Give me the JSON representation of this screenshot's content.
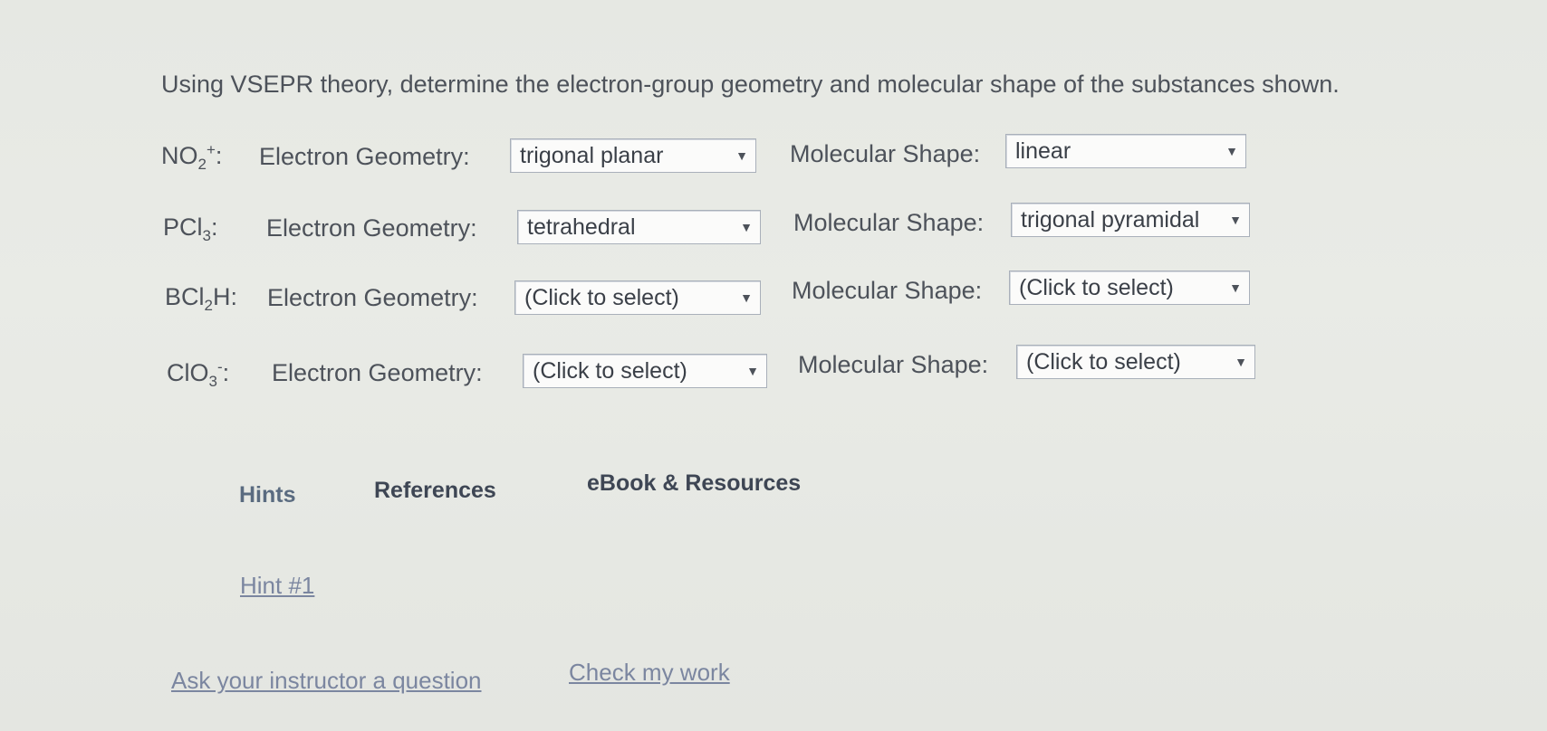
{
  "question": "Using VSEPR theory, determine the electron-group geometry and molecular shape of the substances shown.",
  "rows": [
    {
      "formula_base": "NO",
      "formula_sub": "2",
      "formula_sup": "+",
      "formula_end": ":",
      "eg_label": "Electron Geometry:",
      "eg_value": "trigonal planar",
      "ms_label": "Molecular Shape:",
      "ms_value": "linear"
    },
    {
      "formula_base": "PCl",
      "formula_sub": "3",
      "formula_sup": "",
      "formula_end": ":",
      "eg_label": "Electron Geometry:",
      "eg_value": "tetrahedral",
      "ms_label": "Molecular Shape:",
      "ms_value": "trigonal pyramidal"
    },
    {
      "formula_base": "BCl",
      "formula_sub": "2",
      "formula_sup": "",
      "formula_end": "H:",
      "eg_label": "Electron Geometry:",
      "eg_value": "(Click to select)",
      "ms_label": "Molecular Shape:",
      "ms_value": "(Click to select)"
    },
    {
      "formula_base": "ClO",
      "formula_sub": "3",
      "formula_sup": "-",
      "formula_end": ":",
      "eg_label": "Electron Geometry:",
      "eg_value": "(Click to select)",
      "ms_label": "Molecular Shape:",
      "ms_value": "(Click to select)"
    }
  ],
  "dropdown_arrow": "▼",
  "tabs": {
    "hints": "Hints",
    "references": "References",
    "ebook": "eBook & Resources"
  },
  "hint_link": "Hint #1",
  "footer": {
    "ask": "Ask your instructor a question",
    "check": "Check my work"
  }
}
